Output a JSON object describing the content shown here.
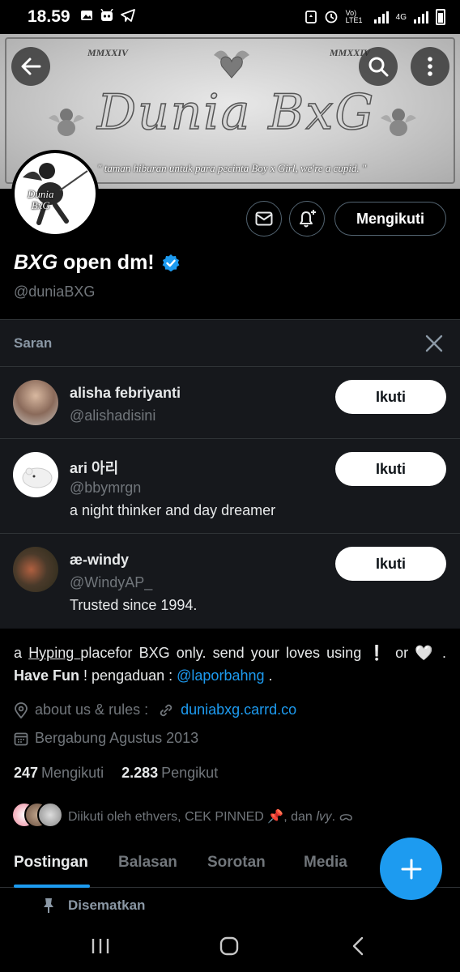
{
  "status_bar": {
    "time": "18.59",
    "network_label": "Vo) LTE1",
    "network_type": "4G"
  },
  "banner": {
    "roman_left": "MMXXIV",
    "roman_right": "MMXXIV",
    "logo_text": "Dunia BxG",
    "tagline": "\" taman hiburan untuk para pecinta Boy x Girl, we're a cupid. \""
  },
  "avatar": {
    "text_line1": "Dunia",
    "text_line2": "BxG"
  },
  "profile": {
    "name_italic": "BXG",
    "name_rest": "open dm!",
    "handle": "@duniaBXG",
    "follow_state_label": "Mengikuti"
  },
  "suggestions": {
    "header": "Saran",
    "items": [
      {
        "name": "alisha febriyanti",
        "handle": "@alishadisini",
        "bio": "",
        "button": "Ikuti"
      },
      {
        "name": "ari 아리",
        "handle": "@bbymrgn",
        "bio": "a night thinker and day dreamer",
        "button": "Ikuti"
      },
      {
        "name": "æ-windy",
        "handle": "@WindyAP_",
        "bio": "Trusted since 1994.",
        "button": "Ikuti"
      }
    ]
  },
  "bio": {
    "p1": "a ",
    "underlined": "Hyping ",
    "p2": "placefor BXG only. send your loves using ❕ or 🤍 . ",
    "bold": "Have Fun",
    "p3": " ! pengaduan : ",
    "mention": "@laporbahng",
    "p4": " ."
  },
  "meta": {
    "location": "about us  & rules  :",
    "website": "duniabxg.carrd.co",
    "joined": "Bergabung Agustus 2013"
  },
  "counts": {
    "following_num": "247",
    "following_label": "Mengikuti",
    "followers_num": "2.283",
    "followers_label": "Pengikut"
  },
  "followed_by": "Diikuti oleh ethvers, CEK PINNED 📌, dan 𝐼𝑣𝑦. ᯅ",
  "tabs": [
    "Postingan",
    "Balasan",
    "Sorotan",
    "Media"
  ],
  "pinned_label": "Disematkan",
  "colors": {
    "accent": "#1d9bf0",
    "background": "#000000",
    "card": "#16181c",
    "muted": "#71767b"
  }
}
